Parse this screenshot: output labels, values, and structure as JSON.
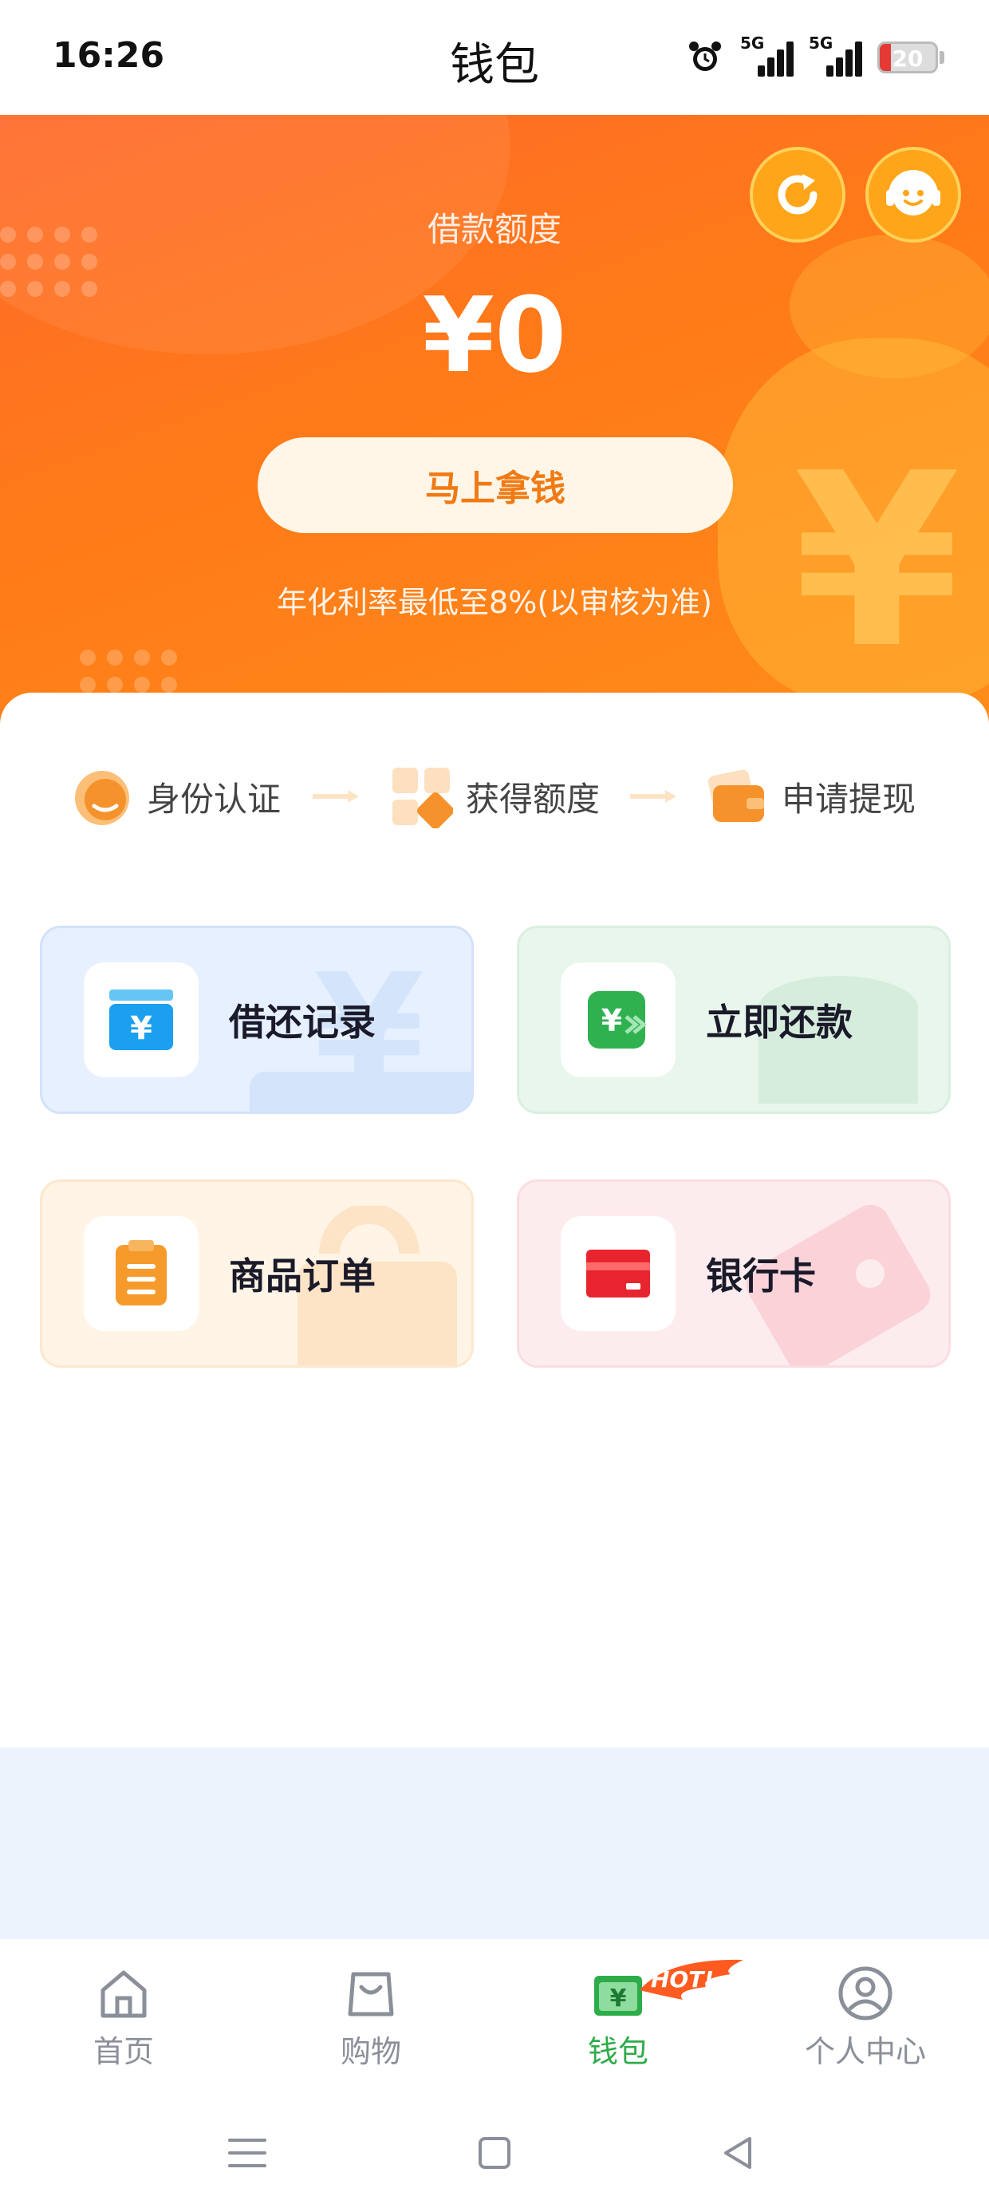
{
  "status_bar": {
    "time": "16:26",
    "title": "钱包",
    "network_1": "5G",
    "network_2": "5G",
    "battery_level": "20",
    "battery_fraction": 0.2
  },
  "hero": {
    "label": "借款额度",
    "amount": "¥0",
    "cta": "马上拿钱",
    "note": "年化利率最低至8%(以审核为准)",
    "accent": "#ff7a18"
  },
  "steps": [
    {
      "label": "身份认证",
      "icon": "identity-icon"
    },
    {
      "label": "获得额度",
      "icon": "quota-icon"
    },
    {
      "label": "申请提现",
      "icon": "wallet-icon"
    }
  ],
  "tiles": {
    "records": {
      "label": "借还记录",
      "icon": "yen-card-icon"
    },
    "repay": {
      "label": "立即还款",
      "icon": "yen-forward-icon"
    },
    "orders": {
      "label": "商品订单",
      "icon": "clipboard-icon"
    },
    "bank_card": {
      "label": "银行卡",
      "icon": "bank-card-icon"
    }
  },
  "bottom_nav": {
    "items": [
      {
        "label": "首页",
        "icon": "home-icon"
      },
      {
        "label": "购物",
        "icon": "shopping-bag-icon"
      },
      {
        "label": "钱包",
        "icon": "wallet-nav-icon",
        "badge": "HOT!"
      },
      {
        "label": "个人中心",
        "icon": "user-icon"
      }
    ],
    "active_color": "#2eac4a"
  }
}
